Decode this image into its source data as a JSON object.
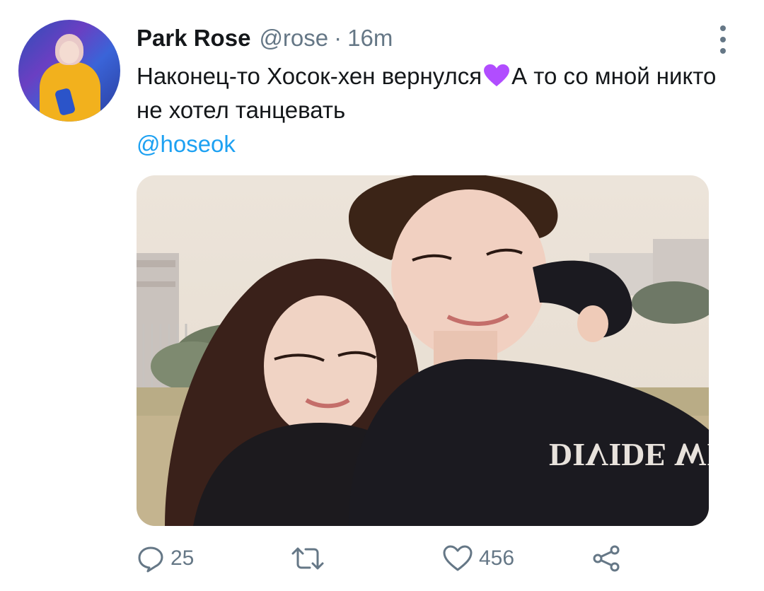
{
  "tweet": {
    "author_name": "Park Rose",
    "handle": "@rose",
    "separator": "·",
    "time": "16m",
    "text_part1": "Наконец-то Хосок-хен вернулся",
    "text_part2": "А то со мной никто не хотел танцевать",
    "mention": "@hoseok",
    "heart_emoji": "purple-heart-icon"
  },
  "media": {
    "sweatshirt_print": "DIVIDE WIN"
  },
  "actions": {
    "reply_count": "25",
    "retweet_count": "",
    "like_count": "456"
  },
  "colors": {
    "text": "#14171a",
    "secondary": "#657786",
    "link": "#1da1f2",
    "heart": "#b14dff"
  }
}
